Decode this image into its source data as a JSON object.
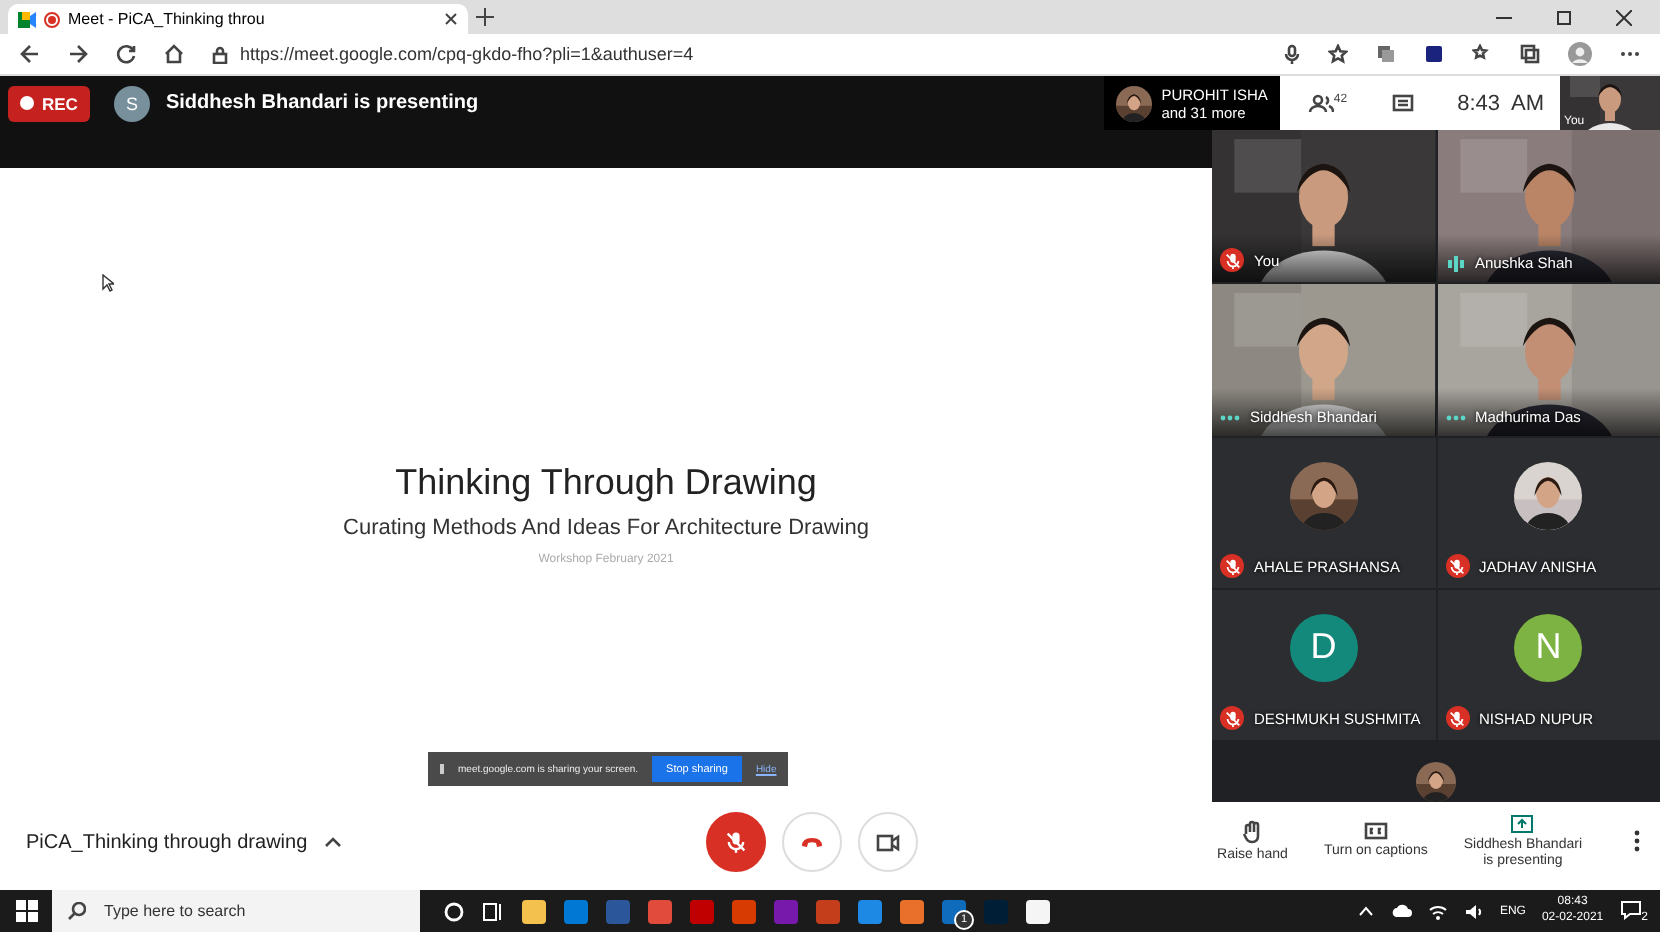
{
  "browser": {
    "tab_title": "Meet - PiCA_Thinking throu",
    "url": "https://meet.google.com/cpq-gkdo-fho?pli=1&authuser=4"
  },
  "top_bar": {
    "rec": "REC",
    "presenter_initial": "S",
    "presenting": "Siddhesh Bhandari is presenting",
    "preview_name": "PUROHIT ISHA",
    "preview_more": "and 31 more",
    "participant_count": "42",
    "time": "8:43  AM",
    "self_label": "You"
  },
  "slide": {
    "title": "Thinking Through Drawing",
    "subtitle": "Curating Methods And Ideas For Architecture Drawing",
    "note": "Workshop February 2021"
  },
  "share_banner": {
    "text": "meet.google.com is sharing your screen.",
    "stop": "Stop sharing",
    "hide": "Hide"
  },
  "tiles": [
    {
      "kind": "video",
      "name": "You",
      "muted": true
    },
    {
      "kind": "video",
      "name": "Anushka Shah",
      "muted": false,
      "speaking": true
    },
    {
      "kind": "video",
      "name": "Siddhesh Bhandari",
      "muted": false,
      "speaking": false
    },
    {
      "kind": "video",
      "name": "Madhurima Das",
      "muted": false,
      "speaking": false
    },
    {
      "name": "AHALE PRASHANSA",
      "muted": true
    },
    {
      "name": "JADHAV ANISHA",
      "muted": true
    },
    {
      "kind": "letter",
      "letter": "D",
      "color": "#12897b",
      "name": "DESHMUKH SUSHMITA",
      "muted": true
    },
    {
      "kind": "letter",
      "letter": "N",
      "color": "#7cb342",
      "name": "NISHAD NUPUR",
      "muted": true
    },
    {
      "kind": "partial"
    }
  ],
  "bottom_bar": {
    "meeting_name": "PiCA_Thinking through drawing",
    "raise_hand": "Raise hand",
    "captions": "Turn on captions",
    "presenting": "Siddhesh Bhandari\nis presenting"
  },
  "taskbar": {
    "search_placeholder": "Type here to search",
    "apps": [
      {
        "color": "#f2c14e"
      },
      {
        "color": "#0078d4"
      },
      {
        "color": "#2b579a"
      },
      {
        "color": "#e04b3c"
      },
      {
        "color": "#c00000"
      },
      {
        "color": "#d83b01"
      },
      {
        "color": "#7719aa"
      },
      {
        "color": "#c43e1c"
      },
      {
        "color": "#1e88e5"
      },
      {
        "color": "#e8702a"
      },
      {
        "color": "#0f6cbd",
        "badge": "1"
      },
      {
        "color": "#001e36"
      },
      {
        "color": "#f5f5f5"
      }
    ],
    "language": "ENG",
    "time": "08:43",
    "date": "02-02-2021",
    "notifications": "2"
  }
}
